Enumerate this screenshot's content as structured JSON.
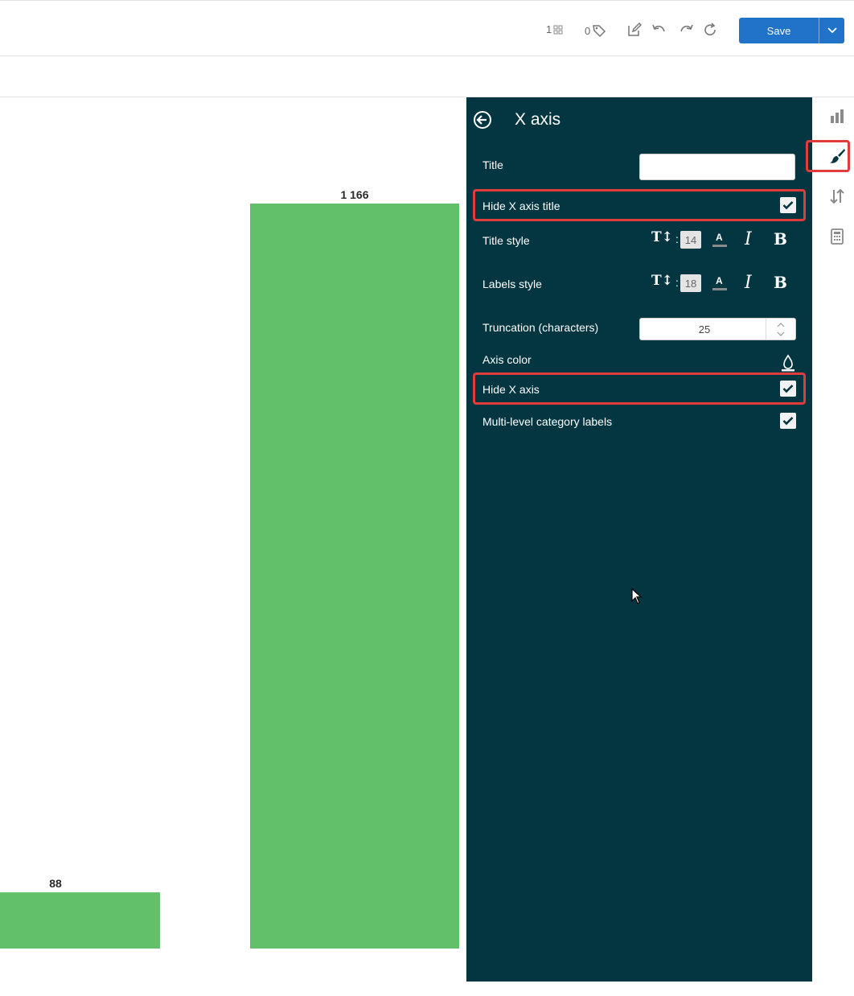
{
  "toolbar": {
    "count_widgets": "1",
    "count_tags": "0",
    "save_label": "Save"
  },
  "chart_data": {
    "type": "bar",
    "categories": [
      "",
      ""
    ],
    "values": [
      88,
      1166
    ],
    "value_labels": [
      "88",
      "1 166"
    ],
    "color": "#62bf6a",
    "title": "",
    "xlabel": "",
    "ylabel": ""
  },
  "panel": {
    "title": "X axis",
    "title_label": "Title",
    "title_value": "",
    "hide_title_label": "Hide X axis title",
    "hide_title_checked": true,
    "title_style_label": "Title style",
    "title_style_size": "14",
    "labels_style_label": "Labels style",
    "labels_style_size": "18",
    "tt_glyph": "T↕",
    "colon": ":",
    "color_glyph": "A",
    "italic_glyph": "I",
    "bold_glyph": "B",
    "truncation_label": "Truncation (characters)",
    "truncation_value": "25",
    "axis_color_label": "Axis color",
    "hide_axis_label": "Hide X axis",
    "hide_axis_checked": true,
    "multilevel_label": "Multi-level category labels",
    "multilevel_checked": true,
    "background": "#043642",
    "highlight_color": "#e03c3c"
  },
  "icons": {
    "strip": [
      "bar-chart-icon",
      "paint-brush-icon",
      "sort-icon",
      "calculator-icon"
    ]
  }
}
